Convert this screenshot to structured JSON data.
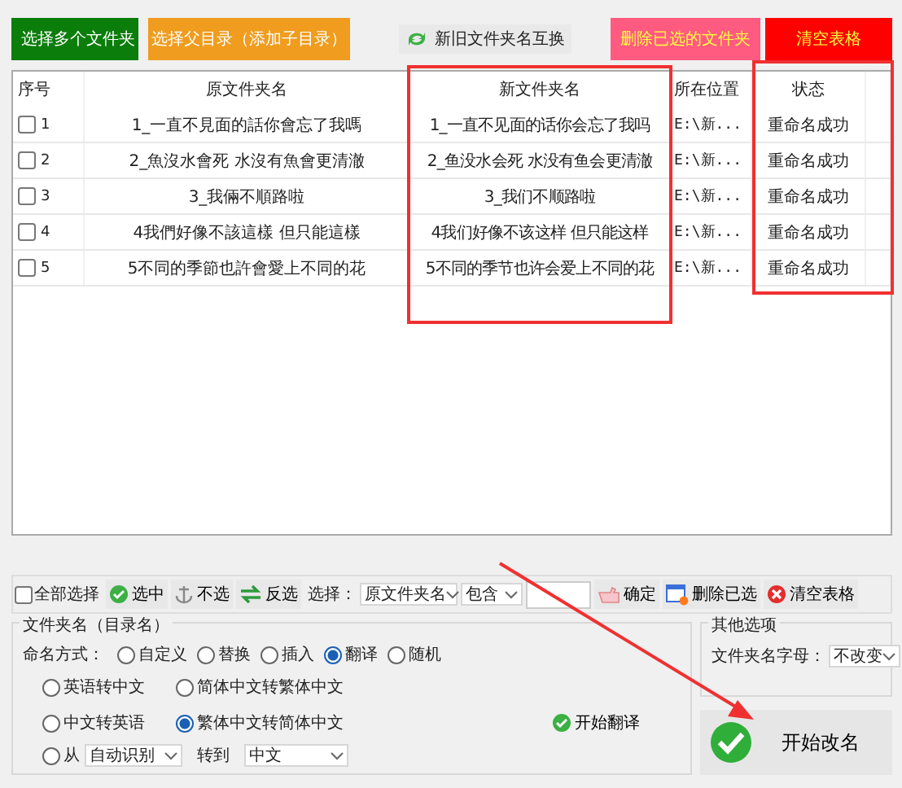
{
  "top_buttons": [
    {
      "label": "选择多个文件夹",
      "kind": "colored",
      "color": "#0b7d0b"
    },
    {
      "label": "选择父目录（添加子目录）",
      "kind": "colored",
      "color": "#f09c1e"
    },
    {
      "label": "新旧文件夹名互换",
      "kind": "swap"
    },
    {
      "label": "删除已选的文件夹",
      "kind": "colored",
      "color": "#ff5a80"
    },
    {
      "label": "清空表格",
      "kind": "colored",
      "color": "#ff0000"
    }
  ],
  "table": {
    "columns": [
      "序号",
      "原文件夹名",
      "新文件夹名",
      "所在位置",
      "状态"
    ],
    "rows": [
      {
        "index": "1",
        "checked": false,
        "original": "1_一直不見面的話你會忘了我嗎",
        "new": "1_一直不见面的话你会忘了我吗",
        "location": "E:\\新...",
        "status": "重命名成功"
      },
      {
        "index": "2",
        "checked": false,
        "original": "2_魚沒水會死 水沒有魚會更清澈",
        "new": "2_鱼没水会死 水没有鱼会更清澈",
        "location": "E:\\新...",
        "status": "重命名成功"
      },
      {
        "index": "3",
        "checked": false,
        "original": "3_我倆不順路啦",
        "new": "3_我们不顺路啦",
        "location": "E:\\新...",
        "status": "重命名成功"
      },
      {
        "index": "4",
        "checked": false,
        "original": "4我們好像不該這樣 但只能這樣",
        "new": "4我们好像不该这样 但只能这样",
        "location": "E:\\新...",
        "status": "重命名成功"
      },
      {
        "index": "5",
        "checked": false,
        "original": "5不同的季節也許會愛上不同的花",
        "new": "5不同的季节也许会爱上不同的花",
        "location": "E:\\新...",
        "status": "重命名成功"
      }
    ]
  },
  "toolbar": {
    "select_all": {
      "label": "全部选择",
      "checked": false
    },
    "buttons": [
      {
        "label": "选中"
      },
      {
        "label": "不选"
      },
      {
        "label": "反选"
      }
    ],
    "filter_label": "选择：",
    "filter_field": "原文件夹名",
    "filter_mode": "包含",
    "actions": [
      {
        "label": "确定"
      },
      {
        "label": "删除已选"
      },
      {
        "label": "清空表格"
      }
    ]
  },
  "name_group": {
    "title": "文件夹名（目录名）",
    "mode_label": "命名方式：",
    "modes": [
      {
        "label": "自定义",
        "selected": false
      },
      {
        "label": "替换",
        "selected": false
      },
      {
        "label": "插入",
        "selected": false
      },
      {
        "label": "翻译",
        "selected": true
      },
      {
        "label": "随机",
        "selected": false
      }
    ],
    "options": [
      {
        "label": "英语转中文",
        "selected": false
      },
      {
        "label": "简体中文转繁体中文",
        "selected": false
      },
      {
        "label": "中文转英语",
        "selected": false
      },
      {
        "label": "繁体中文转简体中文",
        "selected": true
      }
    ],
    "from": {
      "label": "从",
      "selected": false,
      "source": "自动识别",
      "to_label": "转到",
      "target": "中文"
    },
    "translate_button": "开始翻译"
  },
  "other_options": {
    "title": "其他选项",
    "case_label": "文件夹名字母：",
    "case_value": "不改变"
  },
  "start_button": "开始改名"
}
